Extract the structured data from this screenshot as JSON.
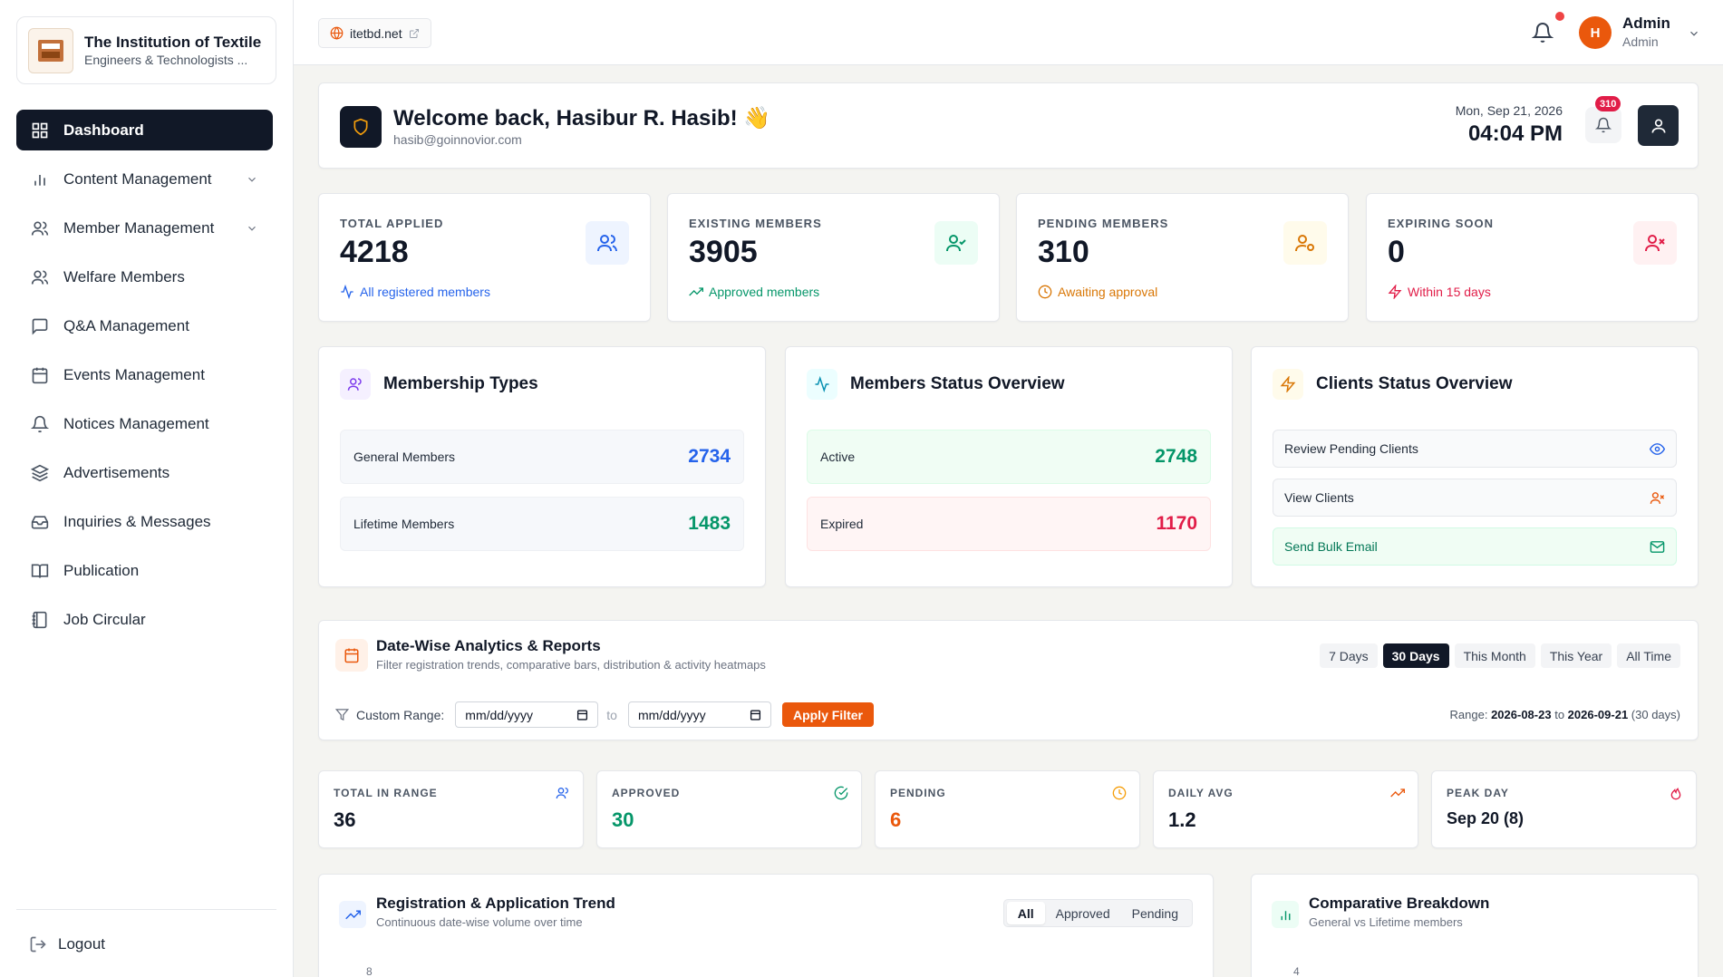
{
  "brand": {
    "title": "The Institution of Textile",
    "subtitle": "Engineers & Technologists ..."
  },
  "sidebar": {
    "items": [
      {
        "label": "Dashboard",
        "icon": "grid-icon",
        "active": true
      },
      {
        "label": "Content Management",
        "icon": "bar-chart-icon",
        "has_children": true
      },
      {
        "label": "Member Management",
        "icon": "users-icon",
        "has_children": true
      },
      {
        "label": "Welfare Members",
        "icon": "users-icon"
      },
      {
        "label": "Q&A Management",
        "icon": "message-icon"
      },
      {
        "label": "Events Management",
        "icon": "calendar-icon"
      },
      {
        "label": "Notices Management",
        "icon": "bell-icon"
      },
      {
        "label": "Advertisements",
        "icon": "layers-icon"
      },
      {
        "label": "Inquiries & Messages",
        "icon": "inbox-icon"
      },
      {
        "label": "Publication",
        "icon": "book-icon"
      },
      {
        "label": "Job Circular",
        "icon": "notebook-icon"
      }
    ],
    "logout": "Logout"
  },
  "topbar": {
    "site_link": "itetbd.net",
    "user": {
      "initial": "H",
      "name": "Admin",
      "role": "Admin"
    }
  },
  "welcome": {
    "title": "Welcome back, Hasibur R. Hasib! 👋",
    "email": "hasib@goinnovior.com",
    "date": "Mon, Sep 21, 2026",
    "time": "04:04 PM",
    "notification_count": "310"
  },
  "stats": [
    {
      "label": "TOTAL APPLIED",
      "value": "4218",
      "note": "All registered members",
      "color": "#2563eb",
      "bg": "#eef4ff"
    },
    {
      "label": "EXISTING MEMBERS",
      "value": "3905",
      "note": "Approved members",
      "color": "#059669",
      "bg": "#ecfdf5"
    },
    {
      "label": "PENDING MEMBERS",
      "value": "310",
      "note": "Awaiting approval",
      "color": "#d97706",
      "bg": "#fffbeb"
    },
    {
      "label": "EXPIRING SOON",
      "value": "0",
      "note": "Within 15 days",
      "color": "#e11d48",
      "bg": "#fff1f2"
    }
  ],
  "membership_types": {
    "title": "Membership Types",
    "rows": [
      {
        "label": "General Members",
        "value": "2734"
      },
      {
        "label": "Lifetime Members",
        "value": "1483"
      }
    ]
  },
  "members_status": {
    "title": "Members Status Overview",
    "rows": [
      {
        "label": "Active",
        "value": "2748"
      },
      {
        "label": "Expired",
        "value": "1170"
      }
    ]
  },
  "clients_status": {
    "title": "Clients Status Overview",
    "actions": [
      {
        "label": "Review Pending Clients",
        "icon": "eye-icon"
      },
      {
        "label": "View Clients",
        "icon": "user-x-icon"
      },
      {
        "label": "Send Bulk Email",
        "icon": "mail-icon"
      }
    ]
  },
  "analytics": {
    "title": "Date-Wise Analytics & Reports",
    "subtitle": "Filter registration trends, comparative bars, distribution & activity heatmaps",
    "ranges": [
      "7 Days",
      "30 Days",
      "This Month",
      "This Year",
      "All Time"
    ],
    "selected_range": "30 Days",
    "custom_range_label": "Custom Range:",
    "date_placeholder": "mm/dd/yyyy",
    "to_label": "to",
    "apply_label": "Apply Filter",
    "range_prefix": "Range:",
    "range_start": "2026-08-23",
    "range_to": "to",
    "range_end": "2026-09-21",
    "range_days": "(30 days)"
  },
  "mini_stats": [
    {
      "label": "TOTAL IN RANGE",
      "value": "36",
      "color": "#111827",
      "icon_color": "#2563eb",
      "icon": "users-icon"
    },
    {
      "label": "APPROVED",
      "value": "30",
      "color": "#059669",
      "icon_color": "#059669",
      "icon": "check-circle-icon"
    },
    {
      "label": "PENDING",
      "value": "6",
      "color": "#ea580c",
      "icon_color": "#f59e0b",
      "icon": "clock-icon"
    },
    {
      "label": "DAILY AVG",
      "value": "1.2",
      "color": "#111827",
      "icon_color": "#ea580c",
      "icon": "trending-up-icon"
    },
    {
      "label": "PEAK DAY",
      "value": "Sep 20 (8)",
      "color": "#111827",
      "icon_color": "#e11d48",
      "icon": "flame-icon"
    }
  ],
  "trend": {
    "title": "Registration & Application Trend",
    "subtitle": "Continuous date-wise volume over time",
    "tabs": [
      "All",
      "Approved",
      "Pending"
    ],
    "selected_tab": "All",
    "axis_top": "8"
  },
  "breakdown": {
    "title": "Comparative Breakdown",
    "subtitle": "General vs Lifetime members",
    "axis_top": "4"
  }
}
